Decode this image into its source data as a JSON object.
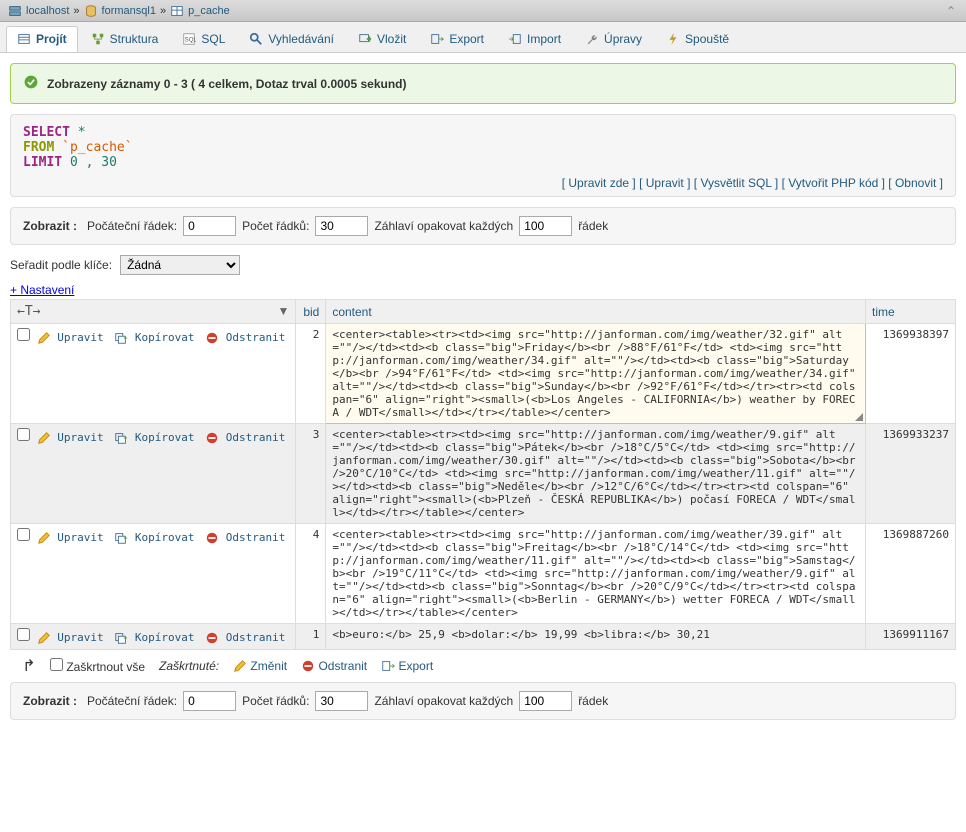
{
  "breadcrumb": {
    "host": "localhost",
    "db": "formansql1",
    "table": "p_cache",
    "sep": " » "
  },
  "tabs": [
    {
      "label": "Projít",
      "active": true
    },
    {
      "label": "Struktura"
    },
    {
      "label": "SQL"
    },
    {
      "label": "Vyhledávání"
    },
    {
      "label": "Vložit"
    },
    {
      "label": "Export"
    },
    {
      "label": "Import"
    },
    {
      "label": "Úpravy"
    },
    {
      "label": "Spouště"
    }
  ],
  "ok_msg": "Zobrazeny záznamy 0 - 3 ( 4 celkem, Dotaz trval 0.0005 sekund)",
  "sql": {
    "select": "SELECT",
    "star": "*",
    "from": "FROM",
    "table": "`p_cache`",
    "limit": "LIMIT",
    "nums": "0 , 30"
  },
  "sql_links": {
    "edit_here": "Upravit zde",
    "edit": "Upravit",
    "explain": "Vysvětlit SQL",
    "php": "Vytvořit PHP kód",
    "refresh": "Obnovit"
  },
  "pager": {
    "show": "Zobrazit :",
    "start_row": "Počáteční řádek:",
    "start_val": "0",
    "count": "Počet řádků:",
    "count_val": "30",
    "header_repeat": "Záhlaví opakovat každých",
    "header_val": "100",
    "rows": "řádek"
  },
  "sort": {
    "label": "Seřadit podle klíče:",
    "value": "Žádná"
  },
  "settings": "+ Nastavení",
  "arrows": "←T→",
  "cols": {
    "bid": "bid",
    "content": "content",
    "time": "time"
  },
  "row_actions": {
    "edit": "Upravit",
    "copy": "Kopírovat",
    "delete": "Odstranit"
  },
  "rows": [
    {
      "bid": "2",
      "time": "1369938397",
      "content": "<center><table><tr><td><img src=\"http://janforman.com/img/weather/32.gif\" alt=\"\"/></td><td><b class=\"big\">Friday</b><br />88&#176;F/61&#176;F</td> <td><img src=\"http://janforman.com/img/weather/34.gif\" alt=\"\"/></td><td><b class=\"big\">Saturday</b><br />94&#176;F/61&#176;F</td> <td><img src=\"http://janforman.com/img/weather/34.gif\" alt=\"\"/></td><td><b class=\"big\">Sunday</b><br />92&#176;F/61&#176;F</td></tr><tr><td colspan=\"6\" align=\"right\"><small>(<b>Los Angeles - CALIFORNIA</b>) weather by FORECA / WDT</small></td></tr></table></center>"
    },
    {
      "bid": "3",
      "time": "1369933237",
      "content": "<center><table><tr><td><img src=\"http://janforman.com/img/weather/9.gif\" alt=\"\"/></td><td><b class=\"big\">Pátek</b><br />18&#176;C/5&#176;C</td> <td><img src=\"http://janforman.com/img/weather/30.gif\" alt=\"\"/></td><td><b class=\"big\">Sobota</b><br />20&#176;C/10&#176;C</td> <td><img src=\"http://janforman.com/img/weather/11.gif\" alt=\"\"/></td><td><b class=\"big\">Neděle</b><br />12&#176;C/6&#176;C</td></tr><tr><td colspan=\"6\" align=\"right\"><small>(<b>Plzeň - ČESKÁ REPUBLIKA</b>) počasí FORECA / WDT</small></td></tr></table></center>"
    },
    {
      "bid": "4",
      "time": "1369887260",
      "content": "<center><table><tr><td><img src=\"http://janforman.com/img/weather/39.gif\" alt=\"\"/></td><td><b class=\"big\">Freitag</b><br />18&#176;C/14&#176;C</td> <td><img src=\"http://janforman.com/img/weather/11.gif\" alt=\"\"/></td><td><b class=\"big\">Samstag</b><br />19&#176;C/11&#176;C</td> <td><img src=\"http://janforman.com/img/weather/9.gif\" alt=\"\"/></td><td><b class=\"big\">Sonntag</b><br />20&#176;C/9&#176;C</td></tr><tr><td colspan=\"6\" align=\"right\"><small>(<b>Berlin - GERMANY</b>) wetter FORECA / WDT</small></td></tr></table></center>"
    },
    {
      "bid": "1",
      "time": "1369911167",
      "content": "<b>euro:</b> 25,9 <b>dolar:</b> 19,99 <b>libra:</b> 30,21"
    }
  ],
  "footer": {
    "check_all": "Zaškrtnout vše",
    "checked": "Zaškrtnuté:",
    "change": "Změnit",
    "delete": "Odstranit",
    "export": "Export"
  }
}
